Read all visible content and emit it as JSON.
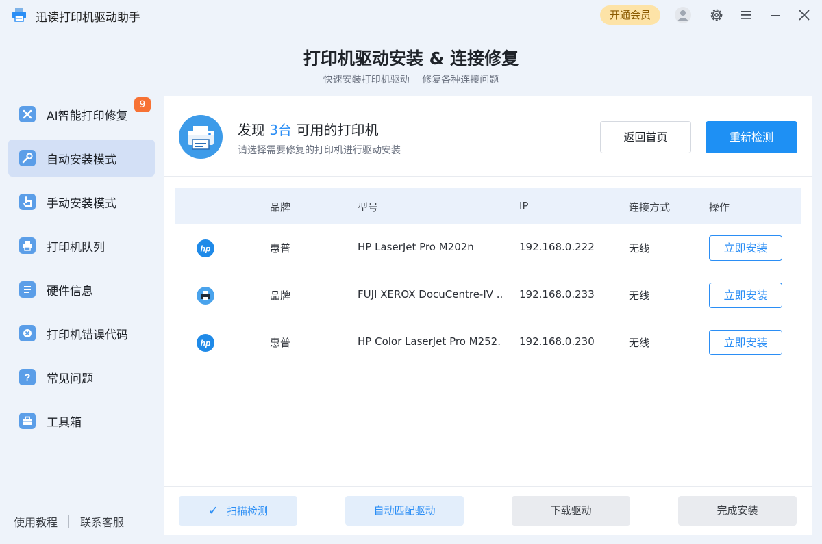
{
  "app": {
    "title": "迅读打印机驱动助手",
    "vip_label": "开通会员",
    "icons": [
      "printer-logo-icon",
      "avatar-icon",
      "gear-icon",
      "menu-icon",
      "minimize-icon",
      "close-icon"
    ]
  },
  "header": {
    "title": "打印机驱动安装 & 连接修复",
    "subtitle": "快速安装打印机驱动 修复各种连接问题"
  },
  "sidebar": {
    "items": [
      {
        "label": "AI智能打印修复",
        "icon": "wrench-screwdriver-icon",
        "badge": "9"
      },
      {
        "label": "自动安装模式",
        "icon": "wrench-icon",
        "active": true
      },
      {
        "label": "手动安装模式",
        "icon": "hand-pointer-icon"
      },
      {
        "label": "打印机队列",
        "icon": "printer-icon"
      },
      {
        "label": "硬件信息",
        "icon": "list-icon"
      },
      {
        "label": "打印机错误代码",
        "icon": "error-x-icon"
      },
      {
        "label": "常见问题",
        "icon": "question-icon"
      },
      {
        "label": "工具箱",
        "icon": "toolbox-icon"
      }
    ],
    "footer": {
      "tutorial": "使用教程",
      "support": "联系客服"
    }
  },
  "found": {
    "prefix": "发现",
    "count": "3台",
    "suffix": "可用的打印机",
    "subtitle": "请选择需要修复的打印机进行驱动安装",
    "home_button": "返回首页",
    "rescan_button": "重新检测"
  },
  "table": {
    "headers": {
      "brand": "品牌",
      "model": "型号",
      "ip": "IP",
      "connection": "连接方式",
      "action": "操作"
    },
    "rows": [
      {
        "icon": "hp-logo-icon",
        "brand": "惠普",
        "model": "HP LaserJet Pro M202n",
        "ip": "192.168.0.222",
        "connection": "无线",
        "action": "立即安装"
      },
      {
        "icon": "printer-icon",
        "brand": "品牌",
        "model": "FUJI XEROX DocuCentre-IV ..",
        "ip": "192.168.0.233",
        "connection": "无线",
        "action": "立即安装"
      },
      {
        "icon": "hp-logo-icon",
        "brand": "惠普",
        "model": "HP Color LaserJet Pro M252.",
        "ip": "192.168.0.230",
        "connection": "无线",
        "action": "立即安装"
      }
    ]
  },
  "steps": [
    {
      "label": "扫描检测",
      "status": "done"
    },
    {
      "label": "自动匹配驱动",
      "status": "done"
    },
    {
      "label": "下载驱动",
      "status": "pending"
    },
    {
      "label": "完成安装",
      "status": "pending"
    }
  ],
  "colors": {
    "accent": "#1e90f4",
    "badge": "#f77234",
    "vip": "#fde3a7"
  }
}
